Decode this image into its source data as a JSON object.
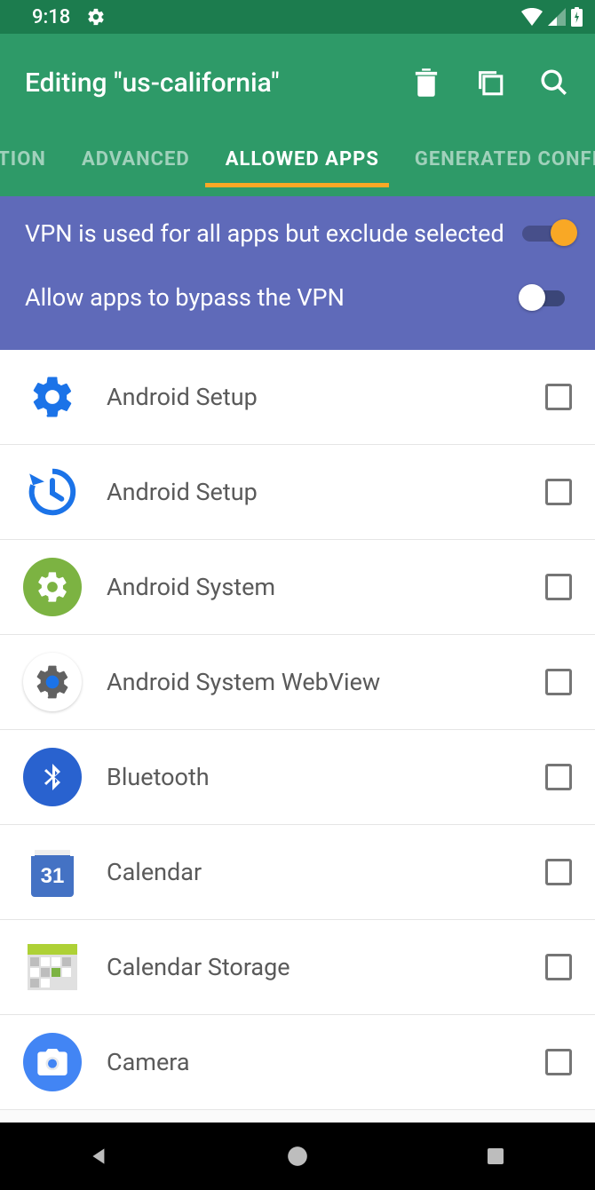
{
  "status": {
    "time": "9:18"
  },
  "header": {
    "title": "Editing \"us-california\""
  },
  "tabs": {
    "items": [
      {
        "label": "PTION"
      },
      {
        "label": "ADVANCED"
      },
      {
        "label": "ALLOWED APPS",
        "active": true
      },
      {
        "label": "GENERATED CONFIG"
      }
    ]
  },
  "settings": {
    "exclude_mode": {
      "label": "VPN is used for all apps but exclude selected",
      "value": true
    },
    "bypass": {
      "label": "Allow apps to bypass the VPN",
      "value": false
    }
  },
  "apps": [
    {
      "name": "Android Setup",
      "icon": "gear-blue",
      "checked": false
    },
    {
      "name": "Android Setup",
      "icon": "restore-blue",
      "checked": false
    },
    {
      "name": "Android System",
      "icon": "gear-green-circle",
      "checked": false
    },
    {
      "name": "Android System WebView",
      "icon": "gear-gray-blue",
      "checked": false
    },
    {
      "name": "Bluetooth",
      "icon": "bluetooth",
      "checked": false
    },
    {
      "name": "Calendar",
      "icon": "calendar-31",
      "checked": false
    },
    {
      "name": "Calendar Storage",
      "icon": "calendar-grid",
      "checked": false
    },
    {
      "name": "Camera",
      "icon": "camera",
      "checked": false
    }
  ]
}
